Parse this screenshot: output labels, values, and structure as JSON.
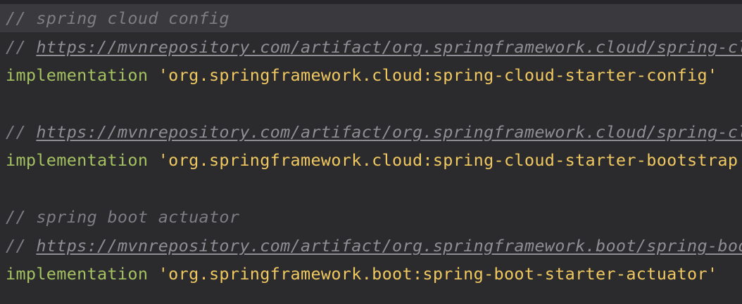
{
  "editor": {
    "lines": [
      {
        "comment": "// spring cloud config"
      },
      {
        "prefix": "// ",
        "url": "https://mvnrepository.com/artifact/org.springframework.cloud/spring-cloud-starter-config"
      },
      {
        "keyword": "implementation",
        "string": "'org.springframework.cloud:spring-cloud-starter-config'"
      },
      {
        "prefix": "// ",
        "url": "https://mvnrepository.com/artifact/org.springframework.cloud/spring-cloud-starter-bootstrap"
      },
      {
        "keyword": "implementation",
        "string": "'org.springframework.cloud:spring-cloud-starter-bootstrap'"
      },
      {
        "comment": "// spring boot actuator"
      },
      {
        "prefix": "// ",
        "url": "https://mvnrepository.com/artifact/org.springframework.boot/spring-boot-starter-actuator"
      },
      {
        "keyword": "implementation",
        "string": "'org.springframework.boot:spring-boot-starter-actuator'"
      }
    ]
  },
  "colors": {
    "background": "#2b2b2e",
    "current_line": "#3a3a3e",
    "comment": "#7d7d83",
    "keyword": "#a5c261",
    "string": "#f0c860"
  }
}
